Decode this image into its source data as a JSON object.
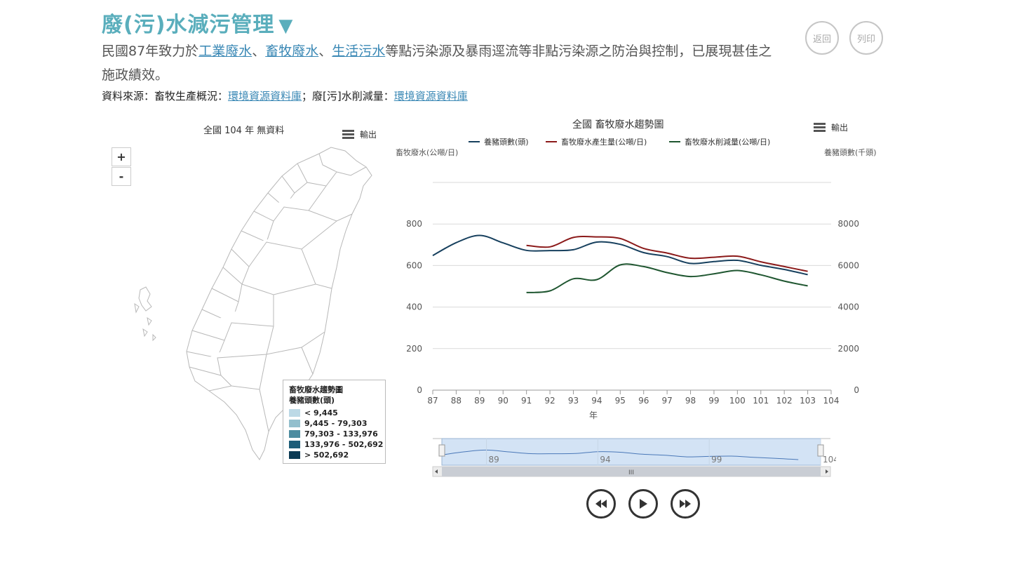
{
  "header": {
    "title": "廢(污)水減污管理",
    "toggle_glyph": "▼",
    "desc_pre": "民國87年致力於",
    "link1": "工業廢水",
    "sep1": "、",
    "link2": "畜牧廢水",
    "sep2": "、",
    "link3": "生活污水",
    "desc_post": "等點污染源及暴雨逕流等非點污染源之防治與控制，已展現甚佳之施政績效。",
    "source_label": "資料來源：畜牧生產概況：",
    "source_link1": "環境資源資料庫",
    "source_mid": "；廢[污]水削減量：",
    "source_link2": "環境資源資料庫"
  },
  "buttons": {
    "back": "返回",
    "print": "列印"
  },
  "map": {
    "title": "全國 104 年 無資料",
    "export_label": "輸出",
    "zoom_in": "+",
    "zoom_out": "-",
    "legend_title1": "畜牧廢水趨勢圖",
    "legend_title2": "養豬頭數(頭)",
    "legend": [
      {
        "label": "< 9,445",
        "color": "#bcd9e6"
      },
      {
        "label": "9,445 - 79,303",
        "color": "#93bfcd"
      },
      {
        "label": "79,303 - 133,976",
        "color": "#4d8ca0"
      },
      {
        "label": "133,976 - 502,692",
        "color": "#1d5d78"
      },
      {
        "label": "> 502,692",
        "color": "#0c3b55"
      }
    ]
  },
  "chart": {
    "export_label": "輸出",
    "navigator_ticks": [
      "89",
      "94",
      "99",
      "104"
    ],
    "navigator_scroll_glyph": "III",
    "controls": [
      "rewind",
      "play",
      "fast-forward"
    ]
  },
  "chart_data": {
    "type": "line",
    "title": "全國 畜牧廢水趨勢圖",
    "xlabel": "年",
    "ylabel_left": "畜牧廢水(公噸/日)",
    "ylabel_right": "養豬頭數(千頭)",
    "x": [
      87,
      88,
      89,
      90,
      91,
      92,
      93,
      94,
      95,
      96,
      97,
      98,
      99,
      100,
      101,
      102,
      103
    ],
    "x_ticks": [
      "87",
      "88",
      "89",
      "90",
      "91",
      "92",
      "93",
      "94",
      "95",
      "96",
      "97",
      "98",
      "99",
      "100",
      "101",
      "102",
      "103",
      "104"
    ],
    "xlim": [
      87,
      104
    ],
    "ylim_left": [
      0,
      1000
    ],
    "ylim_right": [
      0,
      10000
    ],
    "y_ticks_left": [
      "0",
      "200",
      "400",
      "600",
      "800"
    ],
    "y_ticks_right": [
      "0",
      "2000",
      "4000",
      "6000",
      "8000"
    ],
    "grid": true,
    "legend_position": "top",
    "series": [
      {
        "name": "養豬頭數(頭)",
        "axis": "right",
        "color": "#17405e",
        "values": [
          6480,
          7100,
          7450,
          7090,
          6730,
          6720,
          6760,
          7130,
          7020,
          6620,
          6430,
          6100,
          6190,
          6250,
          6010,
          5810,
          5560
        ]
      },
      {
        "name": "畜牧廢水產生量(公噸/日)",
        "axis": "left",
        "color": "#8b1a1a",
        "values": [
          null,
          null,
          null,
          null,
          697,
          690,
          735,
          738,
          730,
          682,
          660,
          635,
          640,
          645,
          618,
          595,
          572
        ]
      },
      {
        "name": "畜牧廢水削減量(公噸/日)",
        "axis": "left",
        "color": "#1f5630",
        "values": [
          null,
          null,
          null,
          null,
          470,
          478,
          536,
          532,
          603,
          595,
          566,
          547,
          560,
          576,
          555,
          525,
          502
        ]
      }
    ]
  }
}
